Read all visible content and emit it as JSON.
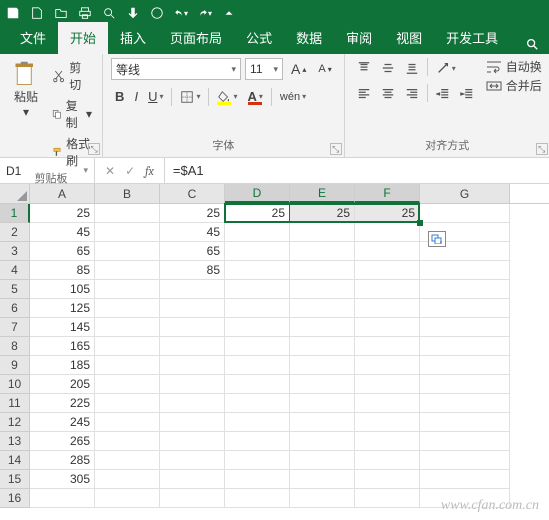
{
  "qat": {
    "icons": [
      "save",
      "new",
      "open",
      "print",
      "preview",
      "format",
      "touch",
      "undo",
      "redo",
      "customize"
    ]
  },
  "tabs": {
    "items": [
      {
        "label": "文件"
      },
      {
        "label": "开始",
        "active": true
      },
      {
        "label": "插入"
      },
      {
        "label": "页面布局"
      },
      {
        "label": "公式"
      },
      {
        "label": "数据"
      },
      {
        "label": "审阅"
      },
      {
        "label": "视图"
      },
      {
        "label": "开发工具"
      }
    ]
  },
  "ribbon": {
    "clipboard": {
      "paste": "粘贴",
      "cut": "剪切",
      "copy": "复制",
      "painter": "格式刷",
      "group": "剪贴板"
    },
    "font": {
      "name": "等线",
      "size": "11",
      "wen": "wén",
      "group": "字体"
    },
    "align": {
      "wrap": "自动换",
      "merge": "合并后",
      "group": "对齐方式"
    }
  },
  "namebox": "D1",
  "formula": "=$A1",
  "cols": [
    "A",
    "B",
    "C",
    "D",
    "E",
    "F",
    "G"
  ],
  "selectedCols": [
    "D",
    "E",
    "F"
  ],
  "selectedRow": 1,
  "activeCell": "D1",
  "cells": {
    "A": [
      "25",
      "45",
      "65",
      "85",
      "105",
      "125",
      "145",
      "165",
      "185",
      "205",
      "225",
      "245",
      "265",
      "285",
      "305",
      ""
    ],
    "B": [
      "",
      "",
      "",
      "",
      "",
      "",
      "",
      "",
      "",
      "",
      "",
      "",
      "",
      "",
      "",
      ""
    ],
    "C": [
      "25",
      "45",
      "65",
      "85",
      "",
      "",
      "",
      "",
      "",
      "",
      "",
      "",
      "",
      "",
      "",
      ""
    ],
    "D": [
      "25",
      "",
      "",
      "",
      "",
      "",
      "",
      "",
      "",
      "",
      "",
      "",
      "",
      "",
      "",
      ""
    ],
    "E": [
      "25",
      "",
      "",
      "",
      "",
      "",
      "",
      "",
      "",
      "",
      "",
      "",
      "",
      "",
      "",
      ""
    ],
    "F": [
      "25",
      "",
      "",
      "",
      "",
      "",
      "",
      "",
      "",
      "",
      "",
      "",
      "",
      "",
      "",
      ""
    ],
    "G": [
      "",
      "",
      "",
      "",
      "",
      "",
      "",
      "",
      "",
      "",
      "",
      "",
      "",
      "",
      "",
      ""
    ]
  },
  "watermark": "www.cfan.com.cn"
}
